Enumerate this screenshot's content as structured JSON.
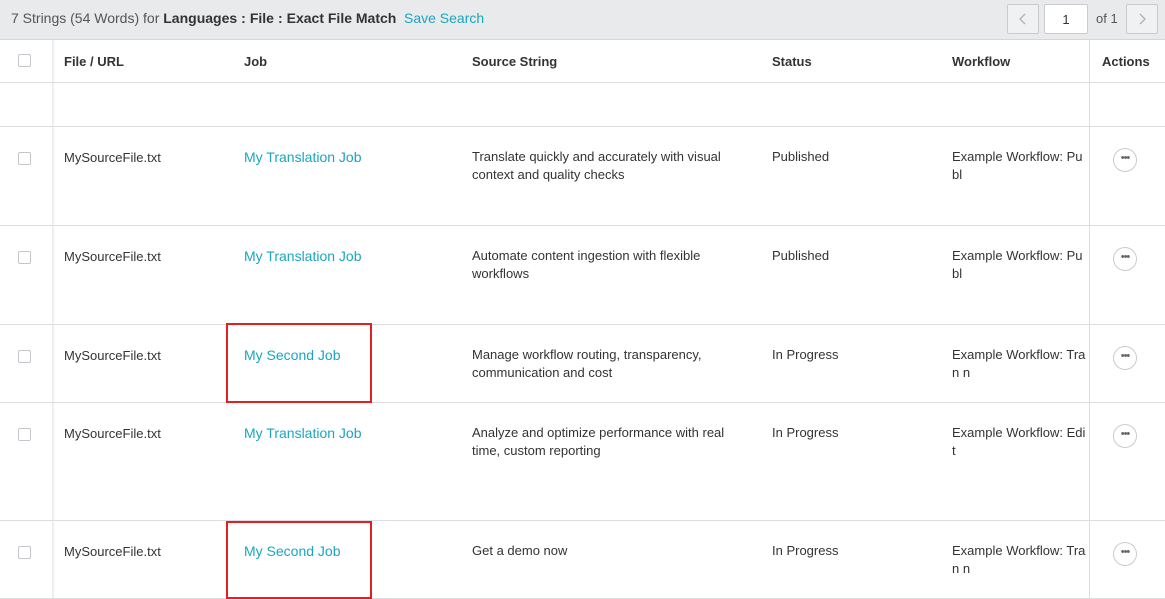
{
  "toolbar": {
    "summary_count": "7 Strings (54 Words)",
    "summary_for": "for",
    "filter_key": "Languages",
    "filter_sep1": ":",
    "filter_file": "File",
    "filter_sep2": ":",
    "filter_value": "Exact File Match",
    "save_search": "Save Search"
  },
  "pager": {
    "prev_icon": "chevron-left-icon",
    "next_icon": "chevron-right-icon",
    "current_page": "1",
    "of_label": "of 1"
  },
  "table": {
    "headers": {
      "file": "File / URL",
      "job": "Job",
      "source": "Source String",
      "status": "Status",
      "workflow": "Workflow",
      "actions": "Actions"
    },
    "rows": [
      {
        "file": "MySourceFile.txt",
        "job": "My Translation Job",
        "source": "Translate quickly and accurately with visual context and quality checks",
        "status": "Published",
        "workflow": "Example Workflow: Publ"
      },
      {
        "file": "MySourceFile.txt",
        "job": "My Translation Job",
        "source": "Automate content ingestion with flexible workflows",
        "status": "Published",
        "workflow": "Example Workflow: Publ"
      },
      {
        "file": "MySourceFile.txt",
        "job": "My Second Job",
        "source": "Manage workflow routing, transparency, communication and cost",
        "status": "In Progress",
        "workflow": "Example Workflow: Tran n"
      },
      {
        "file": "MySourceFile.txt",
        "job": "My Translation Job",
        "source": "Analyze and optimize performance with real time, custom reporting",
        "status": "In Progress",
        "workflow": "Example Workflow: Edit"
      },
      {
        "file": "MySourceFile.txt",
        "job": "My Second Job",
        "source": "Get a demo now",
        "status": "In Progress",
        "workflow": "Example Workflow: Tran n"
      }
    ],
    "actions_icon": "ellipsis-icon"
  },
  "colors": {
    "link": "#1aa6c0",
    "highlight": "#e0211f",
    "toolbar_bg": "#e9eaec"
  }
}
